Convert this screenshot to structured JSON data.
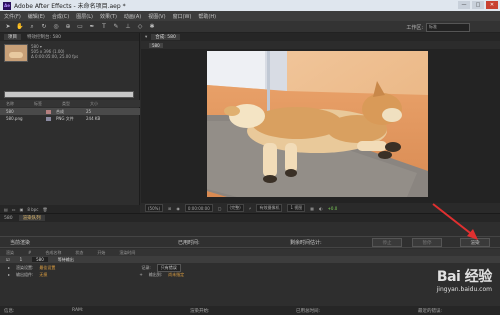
{
  "titlebar": {
    "title": "Adobe After Effects - 未命名项目.aep *",
    "minimize": "—",
    "maximize": "□",
    "close": "✕"
  },
  "menu": [
    "文件(F)",
    "编辑(E)",
    "合成(C)",
    "图层(L)",
    "效果(T)",
    "动画(A)",
    "视图(V)",
    "窗口(W)",
    "帮助(H)"
  ],
  "toolbar": {
    "workspace_label": "工作区:",
    "workspace_value": "标准"
  },
  "project": {
    "tabs": [
      "项目",
      "特效控制台: 580"
    ],
    "thumb_name": "580 ▾",
    "info_line1": "505 x 396 (1.00)",
    "info_line2": "Δ 0:00:05:00, 25.00 fps",
    "columns": [
      "名称",
      "标签",
      "类型",
      "大小"
    ],
    "rows": [
      {
        "name": "580",
        "type": "合成",
        "size": "25"
      },
      {
        "name": "580.png",
        "type": "PNG 文件",
        "size": "244 KB"
      }
    ],
    "footer": "8 bpc"
  },
  "composition": {
    "tab": "合成: 580",
    "sub_tab": "580",
    "footer": {
      "zoom": "(50%)",
      "timecode": "0:00:00:00",
      "quality": "(完整)",
      "camera": "有效摄像机",
      "views": "1 视图",
      "offset": "+0.0"
    }
  },
  "render_queue": {
    "tabs": [
      "580",
      "渲染队列"
    ],
    "current_label": "当前渲染",
    "elapsed_label": "已用时间:",
    "remaining_label": "剩余时间估计:",
    "stop_label": "停止",
    "pause_label": "暂停",
    "render_label": "渲染",
    "columns": [
      "渲染",
      "#",
      "合成名称",
      "状态",
      "开始",
      "渲染时间"
    ],
    "item": {
      "num": "1",
      "comp": "580",
      "status": "等待输出"
    },
    "render_settings_label": "渲染设置:",
    "render_settings_value": "最佳设置",
    "output_module_label": "输出组件:",
    "output_module_value": "无损",
    "log_label": "记录:",
    "log_value": "只有错误",
    "output_to_label": "输出到:",
    "output_to_value": "尚未指定"
  },
  "statusbar": {
    "msg_label": "信息:",
    "ram_label": "RAM:",
    "started_label": "渲染开始:",
    "total_label": "已用总时间:",
    "recent_label": "最近的错误:"
  },
  "watermark": {
    "logo": "Bai 经验",
    "url": "jingyan.baidu.com"
  },
  "colors": {
    "accent_orange": "#e0a040",
    "arrow_red": "#e03030"
  }
}
